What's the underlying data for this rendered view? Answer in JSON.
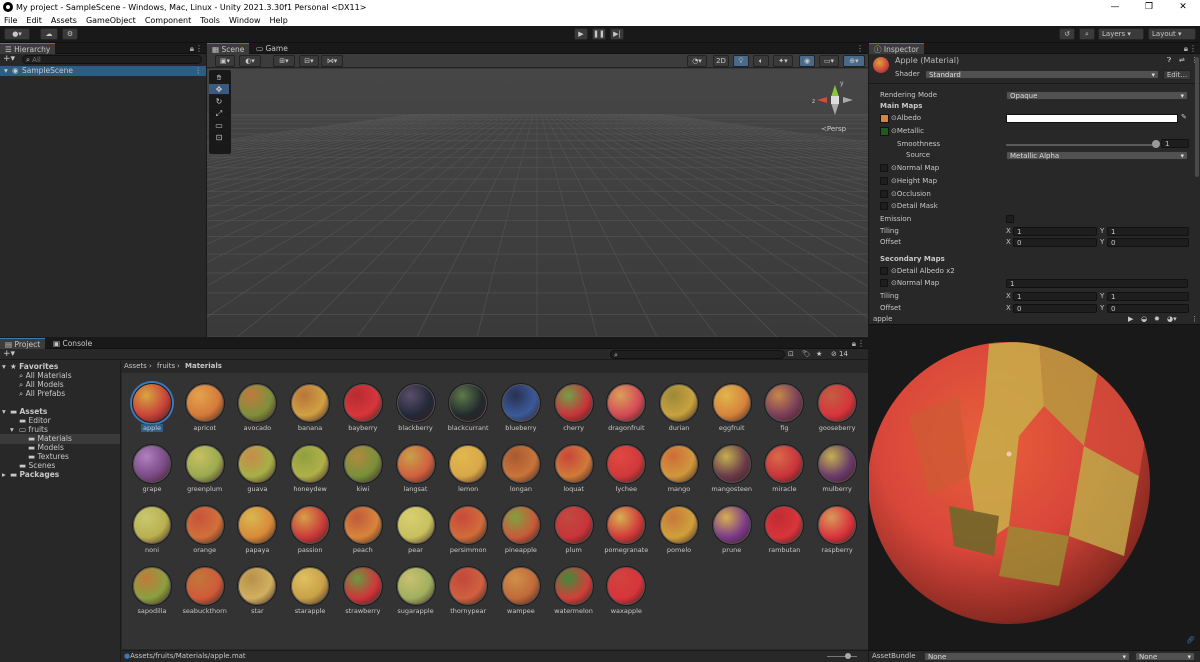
{
  "window": {
    "title": "My project - SampleScene - Windows, Mac, Linux - Unity 2021.3.30f1 Personal <DX11>"
  },
  "menu": [
    "File",
    "Edit",
    "Assets",
    "GameObject",
    "Component",
    "Tools",
    "Window",
    "Help"
  ],
  "toolbar": {
    "layers": "Layers",
    "layout": "Layout"
  },
  "hierarchy": {
    "tab": "Hierarchy",
    "search_placeholder": "All",
    "scene": "SampleScene"
  },
  "scene_view": {
    "tab_scene": "Scene",
    "tab_game": "Game",
    "toggle_2d": "2D",
    "persp": "Persp"
  },
  "inspector": {
    "tab": "Inspector",
    "material_name": "Apple (Material)",
    "shader_label": "Shader",
    "shader_value": "Standard",
    "edit_button": "Edit...",
    "rendering_mode_label": "Rendering Mode",
    "rendering_mode_value": "Opaque",
    "main_maps": "Main Maps",
    "albedo": "Albedo",
    "metallic": "Metallic",
    "smoothness": "Smoothness",
    "smoothness_value": "1",
    "source": "Source",
    "source_value": "Metallic Alpha",
    "normal_map": "Normal Map",
    "height_map": "Height Map",
    "occlusion": "Occlusion",
    "detail_mask": "Detail Mask",
    "emission": "Emission",
    "tiling": "Tiling",
    "offset": "Offset",
    "x": "X",
    "y": "Y",
    "tiling_x": "1",
    "tiling_y": "1",
    "offset_x": "0",
    "offset_y": "0",
    "secondary_maps": "Secondary Maps",
    "detail_albedo": "Detail Albedo x2",
    "normal_map2": "Normal Map",
    "normal_map2_value": "1",
    "tiling2_x": "1",
    "tiling2_y": "1",
    "offset2_x": "0",
    "offset2_y": "0"
  },
  "preview": {
    "name": "apple",
    "assetbundle_label": "AssetBundle",
    "assetbundle_value": "None",
    "variant_value": "None"
  },
  "project": {
    "tab_project": "Project",
    "tab_console": "Console",
    "favorites": "Favorites",
    "fav_items": [
      "All Materials",
      "All Models",
      "All Prefabs"
    ],
    "assets": "Assets",
    "tree": [
      "Editor",
      "fruits",
      "Materials",
      "Models",
      "Textures",
      "Scenes"
    ],
    "packages": "Packages",
    "breadcrumb": [
      "Assets",
      "fruits",
      "Materials"
    ],
    "count": "14",
    "status_path": "Assets/fruits/Materials/apple.mat"
  },
  "materials": [
    {
      "name": "apple",
      "c1": "#c8433a",
      "c2": "#d8a640"
    },
    {
      "name": "apricot",
      "c1": "#d47a3a",
      "c2": "#e3a34d"
    },
    {
      "name": "avocado",
      "c1": "#7f8f3c",
      "c2": "#c07b3e"
    },
    {
      "name": "banana",
      "c1": "#d0a042",
      "c2": "#b8743a"
    },
    {
      "name": "bayberry",
      "c1": "#d8363c",
      "c2": "#b52c30"
    },
    {
      "name": "blackberry",
      "c1": "#232838",
      "c2": "#5a4f6a"
    },
    {
      "name": "blackcurrant",
      "c1": "#222a2e",
      "c2": "#5e7a4a"
    },
    {
      "name": "blueberry",
      "c1": "#3a5a9a",
      "c2": "#2a3050"
    },
    {
      "name": "cherry",
      "c1": "#c8343a",
      "c2": "#6fa148"
    },
    {
      "name": "dragonfruit",
      "c1": "#d44a56",
      "c2": "#d9a05a"
    },
    {
      "name": "durian",
      "c1": "#c8a23e",
      "c2": "#9d8838"
    },
    {
      "name": "eggfruit",
      "c1": "#d6843c",
      "c2": "#e0b54c"
    },
    {
      "name": "fig",
      "c1": "#7a3e5a",
      "c2": "#c7884a"
    },
    {
      "name": "gooseberry",
      "c1": "#d8343c",
      "c2": "#c06040"
    },
    {
      "name": "grape",
      "c1": "#7a4a86",
      "c2": "#b080c0"
    },
    {
      "name": "greenplum",
      "c1": "#9aaa50",
      "c2": "#c8c060"
    },
    {
      "name": "guava",
      "c1": "#a6b048",
      "c2": "#c88a4a"
    },
    {
      "name": "honeydew",
      "c1": "#b0b048",
      "c2": "#90a040"
    },
    {
      "name": "kiwi",
      "c1": "#78903a",
      "c2": "#b08a40"
    },
    {
      "name": "langsat",
      "c1": "#d06040",
      "c2": "#c8a048"
    },
    {
      "name": "lemon",
      "c1": "#d8a848",
      "c2": "#e0b850"
    },
    {
      "name": "longan",
      "c1": "#c8743a",
      "c2": "#a85a30"
    },
    {
      "name": "loquat",
      "c1": "#d07a3a",
      "c2": "#c8463a"
    },
    {
      "name": "lychee",
      "c1": "#d0383c",
      "c2": "#e04a40"
    },
    {
      "name": "mango",
      "c1": "#d0983c",
      "c2": "#d06c3a"
    },
    {
      "name": "mangosteen",
      "c1": "#6a3a4a",
      "c2": "#c4b050"
    },
    {
      "name": "miracle",
      "c1": "#c8343a",
      "c2": "#d86a4a"
    },
    {
      "name": "mulberry",
      "c1": "#6a3a6a",
      "c2": "#c4b050"
    },
    {
      "name": "noni",
      "c1": "#b8b050",
      "c2": "#c8c870"
    },
    {
      "name": "orange",
      "c1": "#d0703a",
      "c2": "#c8543a"
    },
    {
      "name": "papaya",
      "c1": "#d88a3a",
      "c2": "#d8b850"
    },
    {
      "name": "passion",
      "c1": "#c83a3a",
      "c2": "#d8a048"
    },
    {
      "name": "peach",
      "c1": "#d8843c",
      "c2": "#c05a3a"
    },
    {
      "name": "pear",
      "c1": "#c8c060",
      "c2": "#d8d070"
    },
    {
      "name": "persimmon",
      "c1": "#d06c3a",
      "c2": "#c84a3a"
    },
    {
      "name": "pineapple",
      "c1": "#c85a3a",
      "c2": "#80a040"
    },
    {
      "name": "plum",
      "c1": "#c8343a",
      "c2": "#c04a40"
    },
    {
      "name": "pomegranate",
      "c1": "#d03a3a",
      "c2": "#d8b050"
    },
    {
      "name": "pomelo",
      "c1": "#d0a03c",
      "c2": "#c8783a"
    },
    {
      "name": "prune",
      "c1": "#7a3a8a",
      "c2": "#d8b050"
    },
    {
      "name": "rambutan",
      "c1": "#d8343c",
      "c2": "#c02c30"
    },
    {
      "name": "raspberry",
      "c1": "#d8343c",
      "c2": "#d89a5a"
    },
    {
      "name": "sapodilla",
      "c1": "#8aa040",
      "c2": "#c07a3a"
    },
    {
      "name": "seabuckthorn",
      "c1": "#d05a3a",
      "c2": "#c0783a"
    },
    {
      "name": "star",
      "c1": "#d0b060",
      "c2": "#b89048"
    },
    {
      "name": "starapple",
      "c1": "#c8a048",
      "c2": "#e0c060"
    },
    {
      "name": "strawberry",
      "c1": "#d0343a",
      "c2": "#6a9a40"
    },
    {
      "name": "sugarapple",
      "c1": "#a0b060",
      "c2": "#c8c070"
    },
    {
      "name": "thornypear",
      "c1": "#d06040",
      "c2": "#c0483a"
    },
    {
      "name": "wampee",
      "c1": "#c06a3a",
      "c2": "#d09048"
    },
    {
      "name": "watermelon",
      "c1": "#d0403a",
      "c2": "#408a3a"
    },
    {
      "name": "waxapple",
      "c1": "#d8343c",
      "c2": "#d0443c"
    }
  ],
  "colors": {
    "accent": "#3a79bb",
    "selection": "#2c5d87",
    "panel": "#282828",
    "header": "#191919"
  }
}
